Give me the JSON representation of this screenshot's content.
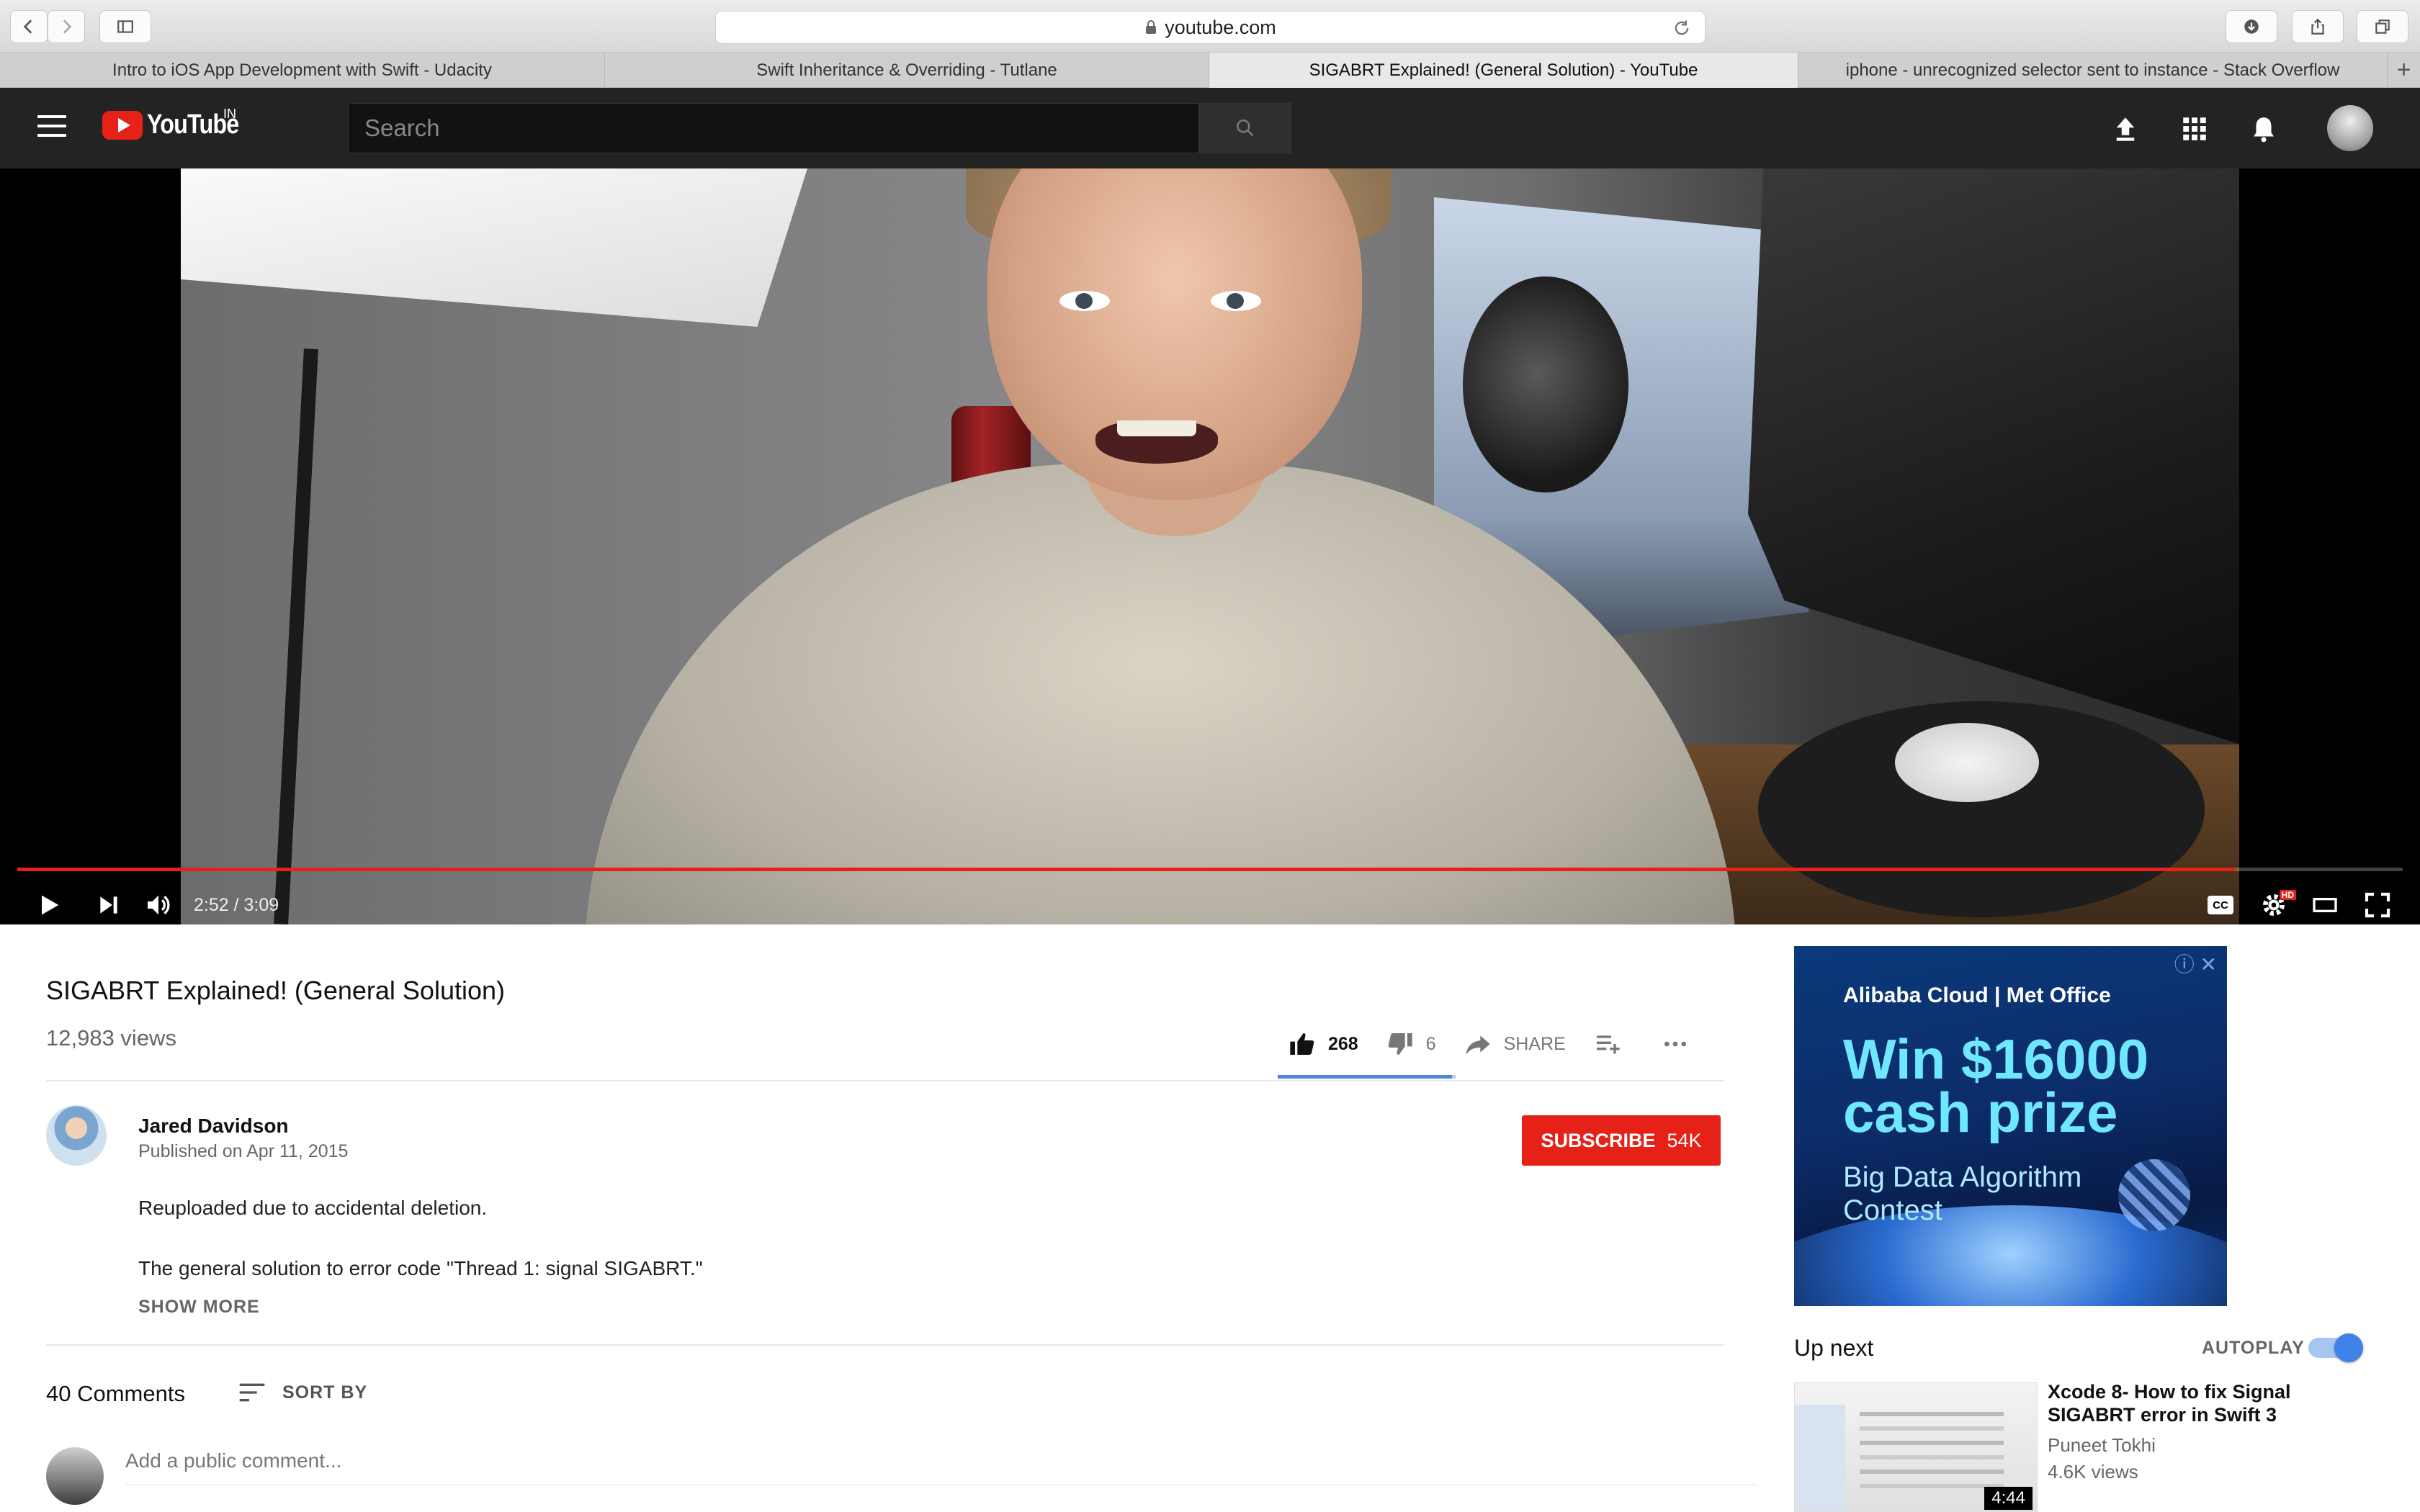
{
  "browser": {
    "url": "youtube.com",
    "tabs": [
      {
        "label": "Intro to iOS App Development with Swift - Udacity",
        "active": false
      },
      {
        "label": "Swift Inheritance & Overriding - Tutlane",
        "active": false
      },
      {
        "label": "SIGABRT Explained! (General Solution) - YouTube",
        "active": true
      },
      {
        "label": "iphone - unrecognized selector sent to instance - Stack Overflow",
        "active": false
      }
    ],
    "new_tab": "+",
    "icons": [
      "back-icon",
      "forward-icon",
      "sidebar-icon",
      "lock-icon",
      "reload-icon",
      "download-icon",
      "share-icon",
      "tabs-overview-icon"
    ]
  },
  "header": {
    "logo_text": "YouTube",
    "country_code": "IN",
    "search_placeholder": "Search",
    "icons": [
      "menu-icon",
      "search-icon",
      "upload-icon",
      "apps-grid-icon",
      "notifications-bell-icon",
      "account-avatar"
    ]
  },
  "player": {
    "time": "2:52 / 3:09",
    "progress_fraction": 0.93,
    "cc_label": "CC",
    "hd_badge": "HD",
    "icons": [
      "play-icon",
      "next-icon",
      "volume-icon",
      "captions-icon",
      "settings-icon",
      "theater-mode-icon",
      "fullscreen-icon"
    ]
  },
  "video": {
    "title": "SIGABRT Explained! (General Solution)",
    "views": "12,983 views",
    "likes": "268",
    "dislikes": "6",
    "like_fraction": 0.978,
    "share_label": "SHARE"
  },
  "channel": {
    "name": "Jared Davidson",
    "published": "Published on Apr 11, 2015",
    "subscribe_label": "SUBSCRIBE",
    "subscriber_count": "54K"
  },
  "description": {
    "lines": [
      "Reuploaded due to accidental deletion.",
      "The general solution to error code \"Thread 1: signal SIGABRT.\""
    ],
    "show_more": "SHOW MORE"
  },
  "comments": {
    "count_label": "40 Comments",
    "sort_label": "SORT BY",
    "input_placeholder": "Add a public comment..."
  },
  "ad": {
    "brand": "Alibaba Cloud  |  Met Office",
    "headline_1": "Win $16000",
    "headline_2": "cash prize",
    "sub_1": "Big Data Algorithm",
    "sub_2": "Contest",
    "close": "ⓘ ✕"
  },
  "sidebar": {
    "up_next": "Up next",
    "autoplay_label": "AUTOPLAY",
    "autoplay_on": true,
    "recommendations": [
      {
        "title": "Xcode 8- How to fix Signal SIGABRT error in Swift 3",
        "channel": "Puneet Tokhi",
        "views": "4.6K views",
        "duration": "4:44"
      }
    ]
  },
  "colors": {
    "youtube_red": "#e62117",
    "header_bg": "#232323",
    "like_blue": "#4f86d5",
    "toggle_blue": "#3f83e8"
  }
}
